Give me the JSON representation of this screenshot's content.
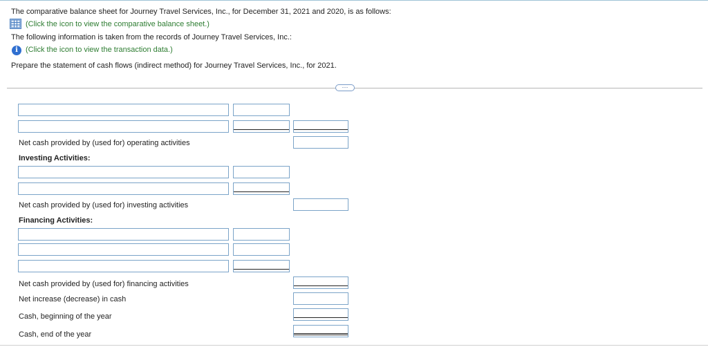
{
  "intro": {
    "line1": "The comparative balance sheet for Journey Travel Services, Inc., for December 31, 2021 and 2020, is as follows:",
    "balance_link": "(Click the icon to view the comparative balance sheet.)",
    "line2": "The following information is taken from the records of Journey Travel Services, Inc.:",
    "transaction_link": "(Click the icon to view the transaction data.)",
    "instruction": "Prepare the statement of cash flows (indirect method) for Journey Travel Services, Inc., for 2021."
  },
  "more_button": "···",
  "info_icon_glyph": "i",
  "labels": {
    "net_operating": "Net cash provided by (used for) operating activities",
    "investing_header": "Investing Activities:",
    "net_investing": "Net cash provided by (used for) investing activities",
    "financing_header": "Financing Activities:",
    "net_financing": "Net cash provided by (used for) financing activities",
    "net_increase": "Net increase (decrease) in cash",
    "cash_beginning": "Cash, beginning of the year",
    "cash_end": "Cash, end of the year"
  },
  "icons": {
    "table": "table-icon",
    "info": "info-icon"
  },
  "colors": {
    "link": "#2e7d32",
    "input_border": "#7aa3c8",
    "info_icon": "#2f6fd0"
  }
}
